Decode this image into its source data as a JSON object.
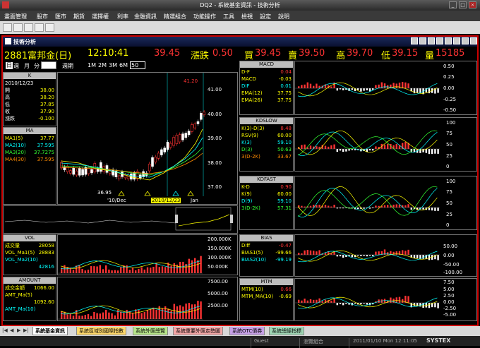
{
  "window": {
    "title": "DQ2 - 系統基金資訊 - 技術分析"
  },
  "menu": [
    "畫面管理",
    "股市",
    "匯市",
    "期貨",
    "選擇權",
    "利率",
    "金融資訊",
    "精選組合",
    "功能操作",
    "工具",
    "檢視",
    "設定",
    "說明"
  ],
  "panel_title": "技術分析",
  "quote": {
    "code_name": "2881富邦金(日)",
    "time": "12:10:41",
    "price": "39.45",
    "chg_label": "漲跌",
    "chg": "0.50",
    "bid_label": "買",
    "bid": "39.45",
    "ask_label": "賣",
    "ask": "39.50",
    "high_label": "高",
    "high": "39.70",
    "low_label": "低",
    "low": "39.15",
    "vol_label": "量",
    "vol": "15185"
  },
  "periods": {
    "day": "週",
    "week": "月",
    "month": "分",
    "period_label": "週期",
    "p1": "1M",
    "p2": "2M",
    "p3": "3M",
    "p4": "6M",
    "count": "50"
  },
  "k_box": {
    "title": "K",
    "date": "2010/12/23",
    "rows": [
      {
        "l": "開",
        "v": "38.00"
      },
      {
        "l": "高",
        "v": "38.20"
      },
      {
        "l": "低",
        "v": "37.85"
      },
      {
        "l": "收",
        "v": "37.90"
      },
      {
        "l": "漲跌",
        "v": "-0.100"
      }
    ]
  },
  "ma_box": {
    "title": "MA",
    "rows": [
      {
        "l": "MA1(5)",
        "v": "37.77"
      },
      {
        "l": "MA2(10)",
        "v": "37.595"
      },
      {
        "l": "MA3(20)",
        "v": "37.7275"
      },
      {
        "l": "MA4(30)",
        "v": "37.595"
      }
    ]
  },
  "main_chart": {
    "high_label": "41.20",
    "low_label": "36.95",
    "yticks": [
      "41.00",
      "40.00",
      "39.00",
      "38.00",
      "37.00"
    ],
    "xlabels": [
      "'10/Dec",
      "2010/12/23",
      "Jan"
    ]
  },
  "vol_box": {
    "title": "VOL",
    "rows": [
      {
        "l": "成交量",
        "v": "28058"
      },
      {
        "l": "VOL_Ma1(5)",
        "v": "28883"
      },
      {
        "l": "VOL_Ma2(10)",
        "v": ""
      },
      {
        "l": "",
        "v": "42816"
      }
    ],
    "yticks": [
      "200.000K",
      "150.000K",
      "100.000K",
      "50.000K"
    ]
  },
  "amount_box": {
    "title": "AMOUNT",
    "rows": [
      {
        "l": "成交金額",
        "v": "1066.00"
      },
      {
        "l": "AMT_Ma(5)",
        "v": ""
      },
      {
        "l": "",
        "v": "1092.60"
      },
      {
        "l": "AMT_Ma(10)",
        "v": ""
      }
    ],
    "yticks": [
      "7500.00",
      "5000.00",
      "2500.00"
    ]
  },
  "macd": {
    "title": "MACD",
    "rows": [
      {
        "l": "D-F",
        "v": "0.04"
      },
      {
        "l": "MACD",
        "v": "-0.03"
      },
      {
        "l": "DIF",
        "v": "0.01"
      },
      {
        "l": "EMA(12)",
        "v": "37.75"
      },
      {
        "l": "EMA(26)",
        "v": "37.75"
      }
    ],
    "yticks": [
      "0.50",
      "0.25",
      "0.00",
      "-0.25",
      "-0.50"
    ]
  },
  "kdslow": {
    "title": "KDSLOW",
    "rows": [
      {
        "l": "K(3)-D(3)",
        "v": "8.48"
      },
      {
        "l": "RSV(9)",
        "v": "60.00"
      },
      {
        "l": "K(3)",
        "v": "59.10"
      },
      {
        "l": "D(3)",
        "v": "50.63"
      },
      {
        "l": "3(D-2K)",
        "v": "33.67"
      }
    ],
    "yticks": [
      "100",
      "75",
      "50",
      "25",
      "0"
    ]
  },
  "kdfast": {
    "title": "KDFAST",
    "rows": [
      {
        "l": "K-D",
        "v": "0.90"
      },
      {
        "l": "K(9)",
        "v": "60.00"
      },
      {
        "l": "D(9)",
        "v": "59.10"
      },
      {
        "l": "3(D-2K)",
        "v": "57.31"
      }
    ],
    "yticks": [
      "100",
      "75",
      "50",
      "25",
      "0"
    ]
  },
  "bias": {
    "title": "BIAS",
    "rows": [
      {
        "l": "Diff",
        "v": "-0.47"
      },
      {
        "l": "BIAS1(5)",
        "v": "-99.66"
      },
      {
        "l": "BIAS2(10)",
        "v": "-99.19"
      }
    ],
    "yticks": [
      "50.00",
      "0.00",
      "-50.00",
      "-100.00"
    ]
  },
  "mtm": {
    "title": "MTM",
    "rows": [
      {
        "l": "MTM(10)",
        "v": "0.66"
      },
      {
        "l": "MTM_MA(10)",
        "v": "-0.69"
      }
    ],
    "yticks": [
      "7.50",
      "5.00",
      "2.50",
      "0.00",
      "-2.50",
      "-5.00"
    ]
  },
  "tabs": [
    "系統基金資訊",
    "系統區域別國際指數",
    "系統外匯總覽",
    "系統重要外匯走勢圖",
    "系統OTC債券",
    "系統總經指標"
  ],
  "status": {
    "user": "Guest",
    "mode": "瀏覽組合",
    "datetime": "2011/01/10 Mon 12:11:05",
    "brand": "SYSTEX"
  }
}
